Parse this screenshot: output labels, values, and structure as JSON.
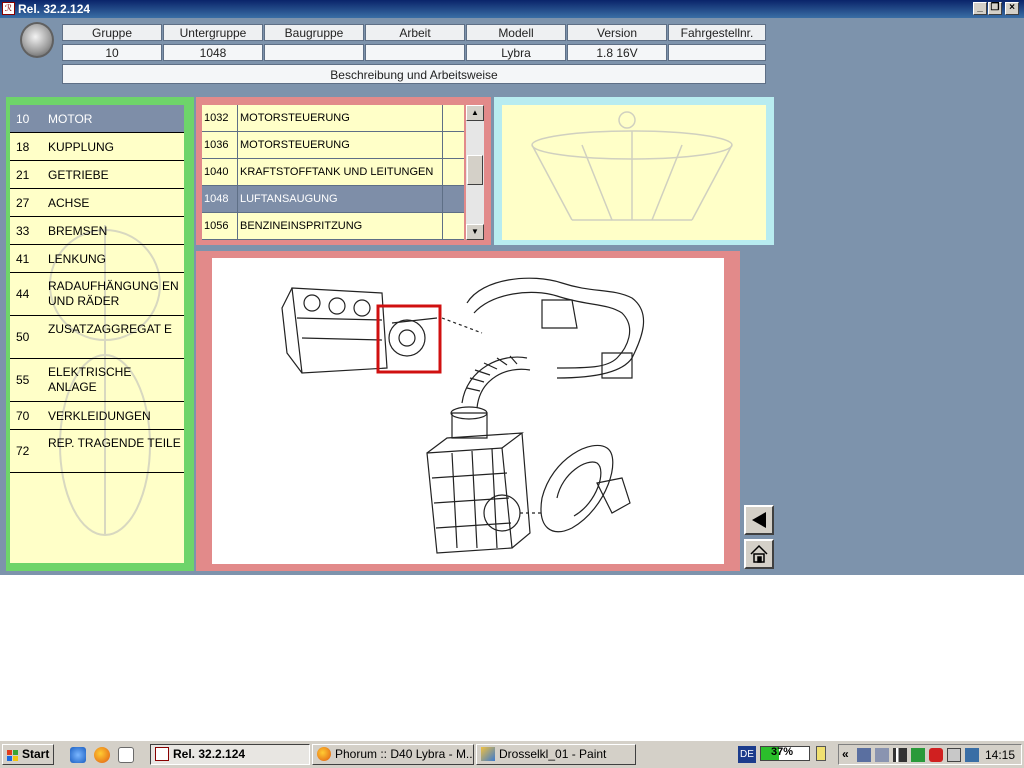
{
  "window": {
    "title": "Rel. 32.2.124",
    "controls": [
      "minimize",
      "restore",
      "close"
    ]
  },
  "header": {
    "columns": [
      {
        "label": "Gruppe",
        "value": "10"
      },
      {
        "label": "Untergruppe",
        "value": "1048"
      },
      {
        "label": "Baugruppe",
        "value": ""
      },
      {
        "label": "Arbeit",
        "value": ""
      },
      {
        "label": "Modell",
        "value": "Lybra"
      },
      {
        "label": "Version",
        "value": "1.8 16V"
      },
      {
        "label": "Fahrgestellnr.",
        "value": ""
      }
    ],
    "description": "Beschreibung und Arbeitsweise",
    "logo_icon": "lancia-logo-icon"
  },
  "groups": [
    {
      "num": "10",
      "label": "MOTOR",
      "selected": true
    },
    {
      "num": "18",
      "label": "KUPPLUNG"
    },
    {
      "num": "21",
      "label": "GETRIEBE"
    },
    {
      "num": "27",
      "label": "ACHSE"
    },
    {
      "num": "33",
      "label": "BREMSEN"
    },
    {
      "num": "41",
      "label": "LENKUNG"
    },
    {
      "num": "44",
      "label": "RADAUFHÄNGUNG EN UND RÄDER"
    },
    {
      "num": "50",
      "label": "ZUSATZAGGREGAT E"
    },
    {
      "num": "55",
      "label": "ELEKTRISCHE ANLAGE"
    },
    {
      "num": "70",
      "label": "VERKLEIDUNGEN"
    },
    {
      "num": "72",
      "label": "REP. TRAGENDE TEILE"
    }
  ],
  "subgroups": [
    {
      "num": "1032",
      "label": "MOTORSTEUERUNG"
    },
    {
      "num": "1036",
      "label": "MOTORSTEUERUNG"
    },
    {
      "num": "1040",
      "label": "KRAFTSTOFFTANK UND LEITUNGEN"
    },
    {
      "num": "1048",
      "label": "LUFTANSAUGUNG",
      "selected": true
    },
    {
      "num": "1056",
      "label": "BENZINEINSPRITZUNG"
    }
  ],
  "scrollbar": {
    "up_icon": "arrow-up-icon",
    "down_icon": "arrow-down-icon"
  },
  "diagram": {
    "subject": "air-intake-assembly-diagram",
    "highlight_color": "#d01010"
  },
  "nav": {
    "back_icon": "triangle-left-icon",
    "home_icon": "home-icon"
  },
  "taskbar": {
    "start_label": "Start",
    "quicklaunch": [
      "ie-icon",
      "firefox-icon",
      "document-icon"
    ],
    "tasks": [
      {
        "label": "Rel. 32.2.124",
        "active": true,
        "icon": "app-icon"
      },
      {
        "label": "Phorum :: D40 Lybra - M...",
        "icon": "firefox-icon"
      },
      {
        "label": "Drosselkl_01 - Paint",
        "icon": "paint-icon"
      }
    ],
    "lang": "DE",
    "battery": "37%",
    "tray_chevron": "«",
    "clock": "14:15"
  },
  "colors": {
    "app_bg": "#7d93ac",
    "panel_yellow": "#ffffc8",
    "groups_border": "#6ed46a",
    "subgroups_border": "#e28a8a",
    "thumb_border": "#b8ecf0",
    "selection": "#7e8ea8"
  }
}
